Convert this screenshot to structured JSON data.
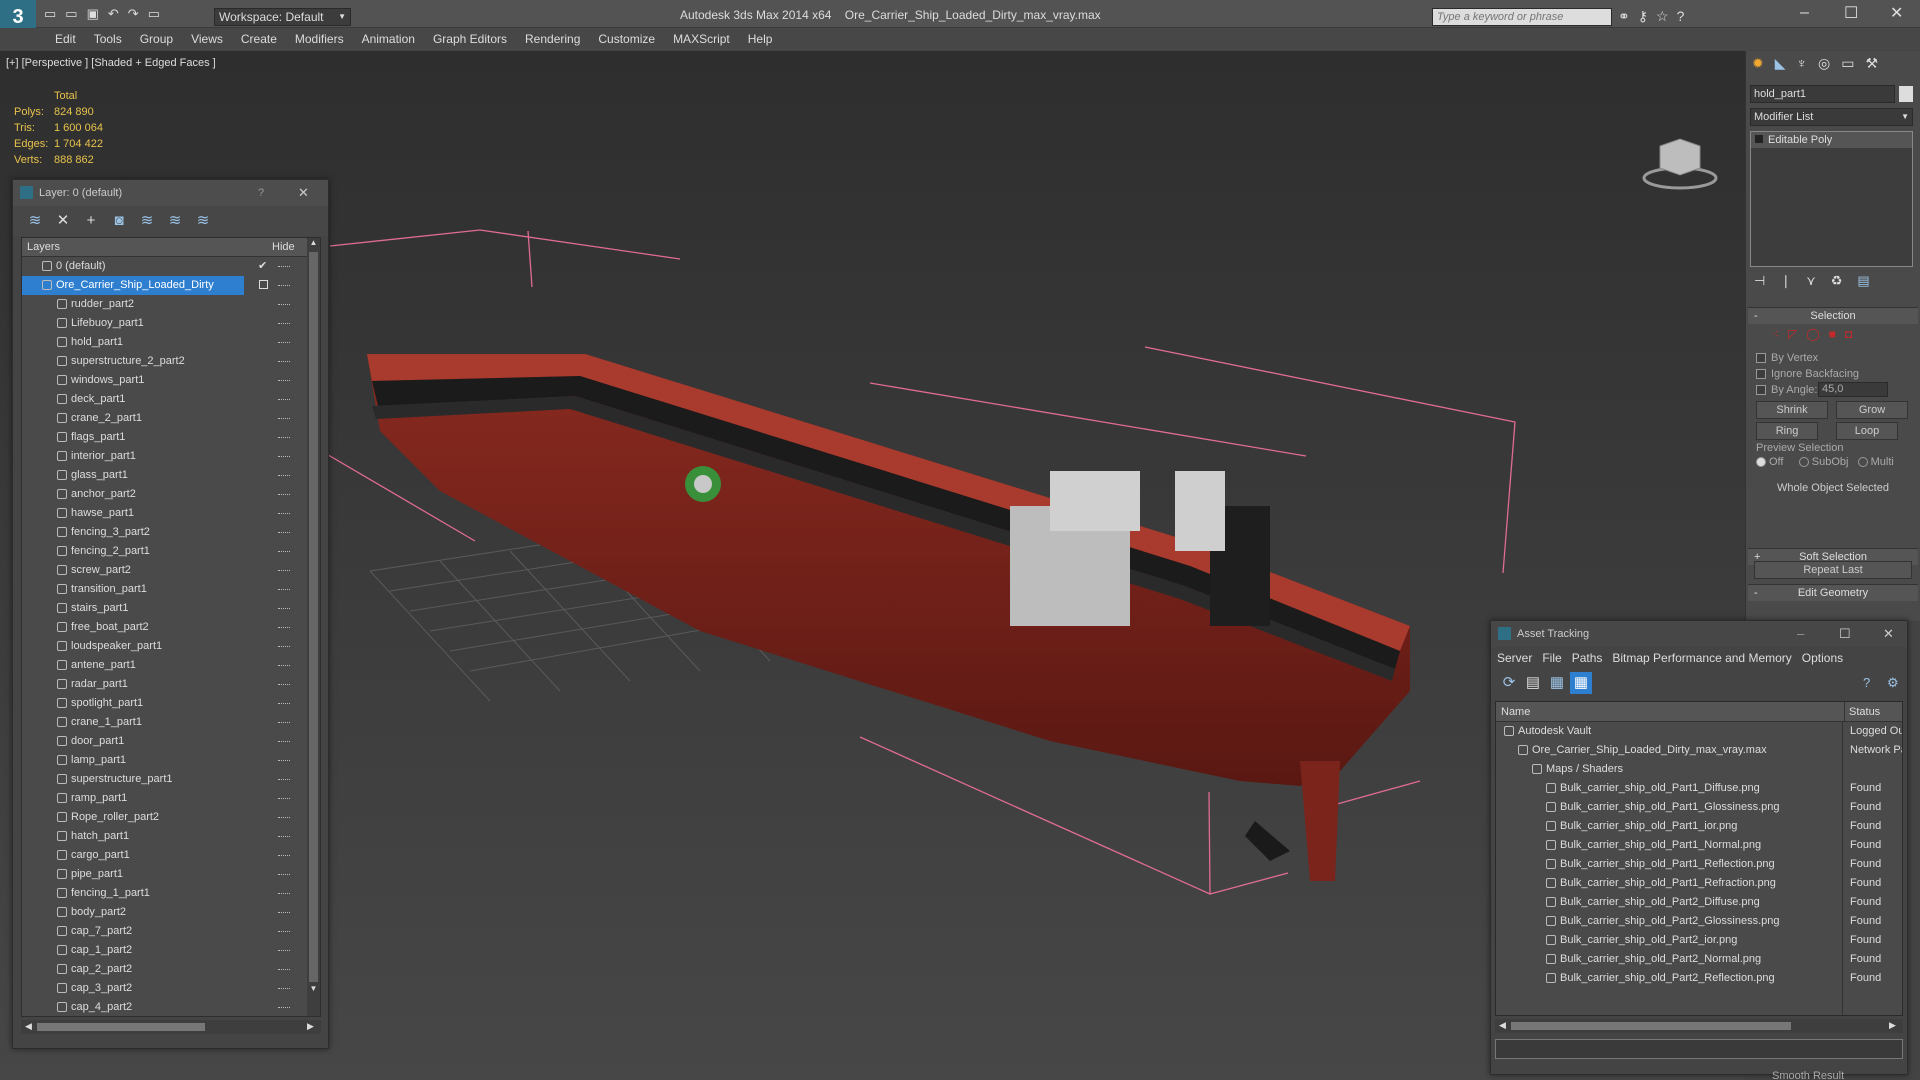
{
  "title": {
    "app": "Autodesk 3ds Max  2014 x64",
    "file": "Ore_Carrier_Ship_Loaded_Dirty_max_vray.max",
    "workspace": "Workspace: Default",
    "search_placeholder": "Type a keyword or phrase"
  },
  "menu": [
    "Edit",
    "Tools",
    "Group",
    "Views",
    "Create",
    "Modifiers",
    "Animation",
    "Graph Editors",
    "Rendering",
    "Customize",
    "MAXScript",
    "Help"
  ],
  "viewport": {
    "label": "[+] [Perspective ] [Shaded + Edged Faces ]",
    "stats": {
      "header": "Total",
      "polys_label": "Polys:",
      "polys": "824 890",
      "tris_label": "Tris:",
      "tris": "1 600 064",
      "edges_label": "Edges:",
      "edges": "1 704 422",
      "verts_label": "Verts:",
      "verts": "888 862"
    }
  },
  "layer_dialog": {
    "title": "Layer: 0 (default)",
    "help": "?",
    "col_layers": "Layers",
    "col_hide": "Hide",
    "default_layer": "0 (default)",
    "selected_layer": "Ore_Carrier_Ship_Loaded_Dirty",
    "items": [
      "rudder_part2",
      "Lifebuoy_part1",
      "hold_part1",
      "superstructure_2_part2",
      "windows_part1",
      "deck_part1",
      "crane_2_part1",
      "flags_part1",
      "interior_part1",
      "glass_part1",
      "anchor_part2",
      "hawse_part1",
      "fencing_3_part2",
      "fencing_2_part1",
      "screw_part2",
      "transition_part1",
      "stairs_part1",
      "free_boat_part2",
      "loudspeaker_part1",
      "antene_part1",
      "radar_part1",
      "spotlight_part1",
      "crane_1_part1",
      "door_part1",
      "lamp_part1",
      "superstructure_part1",
      "ramp_part1",
      "Rope_roller_part2",
      "hatch_part1",
      "cargo_part1",
      "pipe_part1",
      "fencing_1_part1",
      "body_part2",
      "cap_7_part2",
      "cap_1_part2",
      "cap_2_part2",
      "cap_3_part2",
      "cap_4_part2"
    ]
  },
  "command_panel": {
    "object_name": "hold_part1",
    "modifier_list": "Modifier List",
    "stack_item": "Editable Poly",
    "selection_title": "Selection",
    "by_vertex": "By Vertex",
    "ignore_backfacing": "Ignore Backfacing",
    "by_angle": "By Angle:",
    "angle_value": "45,0",
    "shrink": "Shrink",
    "grow": "Grow",
    "ring": "Ring",
    "loop": "Loop",
    "preview_selection": "Preview Selection",
    "off": "Off",
    "subobj": "SubObj",
    "multi": "Multi",
    "whole_object": "Whole Object Selected",
    "soft_selection": "Soft Selection",
    "edit_geometry": "Edit Geometry",
    "repeat_last": "Repeat Last",
    "smooth_result": "Smooth Result"
  },
  "asset_tracking": {
    "title": "Asset Tracking",
    "menu": [
      "Server",
      "File",
      "Paths",
      "Bitmap Performance and Memory",
      "Options"
    ],
    "col_name": "Name",
    "col_status": "Status",
    "rows": [
      {
        "name": "Autodesk Vault",
        "status": "Logged Ou",
        "indent": 0
      },
      {
        "name": "Ore_Carrier_Ship_Loaded_Dirty_max_vray.max",
        "status": "Network Pa",
        "indent": 1
      },
      {
        "name": "Maps / Shaders",
        "status": "",
        "indent": 2
      },
      {
        "name": "Bulk_carrier_ship_old_Part1_Diffuse.png",
        "status": "Found",
        "indent": 3
      },
      {
        "name": "Bulk_carrier_ship_old_Part1_Glossiness.png",
        "status": "Found",
        "indent": 3
      },
      {
        "name": "Bulk_carrier_ship_old_Part1_ior.png",
        "status": "Found",
        "indent": 3
      },
      {
        "name": "Bulk_carrier_ship_old_Part1_Normal.png",
        "status": "Found",
        "indent": 3
      },
      {
        "name": "Bulk_carrier_ship_old_Part1_Reflection.png",
        "status": "Found",
        "indent": 3
      },
      {
        "name": "Bulk_carrier_ship_old_Part1_Refraction.png",
        "status": "Found",
        "indent": 3
      },
      {
        "name": "Bulk_carrier_ship_old_Part2_Diffuse.png",
        "status": "Found",
        "indent": 3
      },
      {
        "name": "Bulk_carrier_ship_old_Part2_Glossiness.png",
        "status": "Found",
        "indent": 3
      },
      {
        "name": "Bulk_carrier_ship_old_Part2_ior.png",
        "status": "Found",
        "indent": 3
      },
      {
        "name": "Bulk_carrier_ship_old_Part2_Normal.png",
        "status": "Found",
        "indent": 3
      },
      {
        "name": "Bulk_carrier_ship_old_Part2_Reflection.png",
        "status": "Found",
        "indent": 3
      }
    ]
  },
  "colors": {
    "hull": "#7a241c",
    "deck": "#a83a2e",
    "accent": "#2f7fd0",
    "stats": "#e8c34c",
    "bbox": "#e06b95"
  }
}
